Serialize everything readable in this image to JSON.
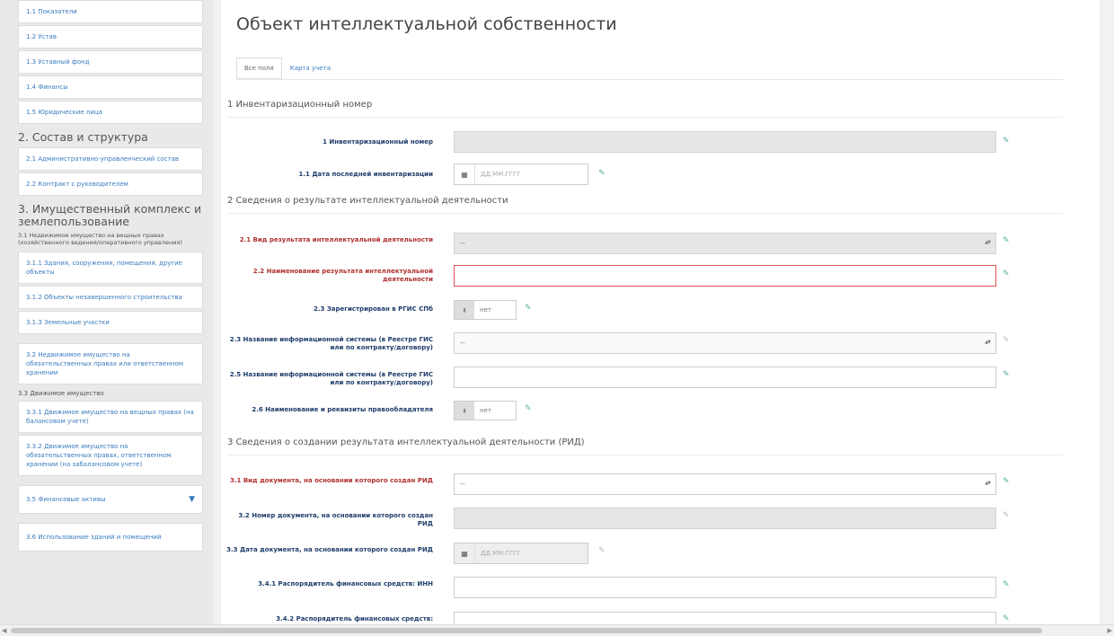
{
  "sidebar": {
    "top_items": [
      "1.1 Показатели",
      "1.2 Устав",
      "1.3 Уставный фонд",
      "1.4 Финансы",
      "1.5 Юридические лица"
    ],
    "section2": {
      "title": "2. Состав и структура",
      "items": [
        "2.1 Административно-управленческий состав",
        "2.2 Контракт с руководителем"
      ]
    },
    "section3": {
      "title": "3. Имущественный комплекс и землепользование",
      "subtitle": "3.1 Недвижимое имущество на вещных правах (хозяйственного ведения/оперативного управления)",
      "items": [
        "3.1.1 Здания, сооружения, помещения, другие объекты",
        "3.1.2 Объекты незавершенного строительства",
        "3.1.3 Земельные участки"
      ],
      "item_32": "3.2 Недвижимое имущество на обязательственных правах или ответственном хранении",
      "label_33": "3.3 Движимое имущество",
      "items_33": [
        "3.3.1 Движимое имущество на вещных правах (на балансовом учете)",
        "3.3.2 Движимое имущество на обязательственных правах, ответственном хранении (на забалансовом учете)"
      ],
      "item_35": "3.5 Финансовые активы",
      "item_36": "3.6 Использование зданий и помещений"
    }
  },
  "main": {
    "title": "Объект интеллектуальной собственности",
    "tabs": [
      "Все поля",
      "Карта учета"
    ],
    "sections": {
      "s1": "1 Инвентаризационный номер",
      "s2": "2 Сведения о результате интеллектуальной деятельности",
      "s3": "3 Сведения о создании результата интеллектуальной деятельности (РИД)"
    },
    "rows": {
      "r1": "1 Инвентаризационный номер",
      "r11": "1.1 Дата последней инвентаризации",
      "r21": "2.1 Вид результата интеллектуальной деятельности",
      "r22": "2.2 Наименование результата интеллектуальной деятельности",
      "r23": "2.3 Зарегистрирован в РГИС СПб",
      "r23b": "2.3 Название информационной системы (в Реестре ГИС или по контракту/договору)",
      "r25": "2.5 Название информационной системы (в Реестре ГИС или по контракту/договору)",
      "r26": "2.6 Наименование и реквизиты правообладателя",
      "r31": "3.1 Вид документа, на основании которого создан РИД",
      "r32": "3.2 Номер документа, на основании которого создан РИД",
      "r33": "3.3 Дата документа, на основании которого создан РИД",
      "r341": "3.4.1 Распорядитель финансовых средств: ИНН",
      "r342": "3.4.2 Распорядитель финансовых средств:"
    },
    "date_placeholder": "ДД.ММ.ГГГГ",
    "select_placeholder": "--",
    "toggle_label": "нет"
  }
}
